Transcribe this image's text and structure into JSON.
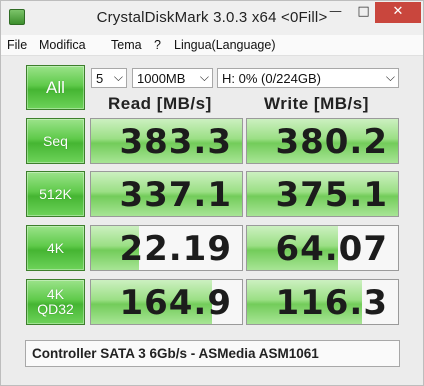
{
  "window": {
    "title": "CrystalDiskMark 3.0.3 x64 <0Fill>",
    "minimize": "—",
    "maximize": "□",
    "close": "✕"
  },
  "menu": [
    "File",
    "Modifica",
    "Tema",
    "?",
    "Lingua(Language)"
  ],
  "controls": {
    "all_label": "All",
    "runs": "5",
    "size": "1000MB",
    "drive": "H: 0% (0/224GB)"
  },
  "headers": {
    "read": "Read [MB/s]",
    "write": "Write [MB/s]"
  },
  "rows": [
    {
      "label": "Seq",
      "label2": "",
      "read": "383.3",
      "write": "380.2",
      "read_fill": 1.0,
      "write_fill": 1.0
    },
    {
      "label": "512K",
      "label2": "",
      "read": "337.1",
      "write": "375.1",
      "read_fill": 1.0,
      "write_fill": 1.0
    },
    {
      "label": "4K",
      "label2": "",
      "read": "22.19",
      "write": "64.07",
      "read_fill": 0.32,
      "write_fill": 0.6
    },
    {
      "label": "4K",
      "label2": "QD32",
      "read": "164.9",
      "write": "116.3",
      "read_fill": 0.8,
      "write_fill": 0.76
    }
  ],
  "status": "Controller SATA 3 6Gb/s - ASMedia ASM1061",
  "colors": {
    "accent_green": "#45b532",
    "close_red": "#c9463d"
  }
}
